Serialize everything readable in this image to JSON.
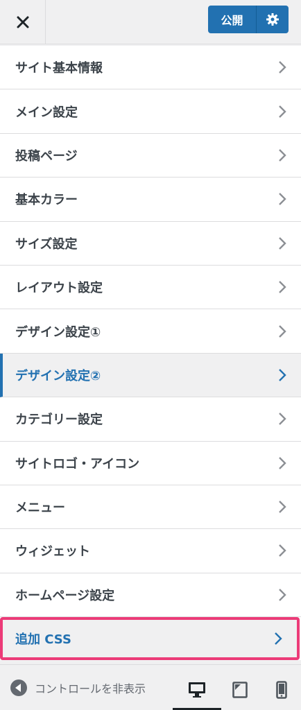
{
  "header": {
    "close_icon": "close-icon",
    "publish_label": "公開",
    "settings_icon": "gear-icon"
  },
  "menu": {
    "items": [
      {
        "label": "サイト基本情報"
      },
      {
        "label": "メイン設定"
      },
      {
        "label": "投稿ページ"
      },
      {
        "label": "基本カラー"
      },
      {
        "label": "サイズ設定"
      },
      {
        "label": "レイアウト設定"
      },
      {
        "label": "デザイン設定①"
      },
      {
        "label": "デザイン設定②",
        "state": "active"
      },
      {
        "label": "カテゴリー設定"
      },
      {
        "label": "サイトロゴ・アイコン"
      },
      {
        "label": "メニュー"
      },
      {
        "label": "ウィジェット"
      },
      {
        "label": "ホームページ設定"
      },
      {
        "label": "追加 CSS",
        "state": "highlighted"
      }
    ]
  },
  "footer": {
    "collapse_label": "コントロールを非表示",
    "devices": [
      "desktop",
      "tablet",
      "mobile"
    ],
    "active_device": "desktop"
  },
  "colors": {
    "accent": "#2271b1",
    "highlight_border": "#ec3b78",
    "text": "#3c434a"
  }
}
